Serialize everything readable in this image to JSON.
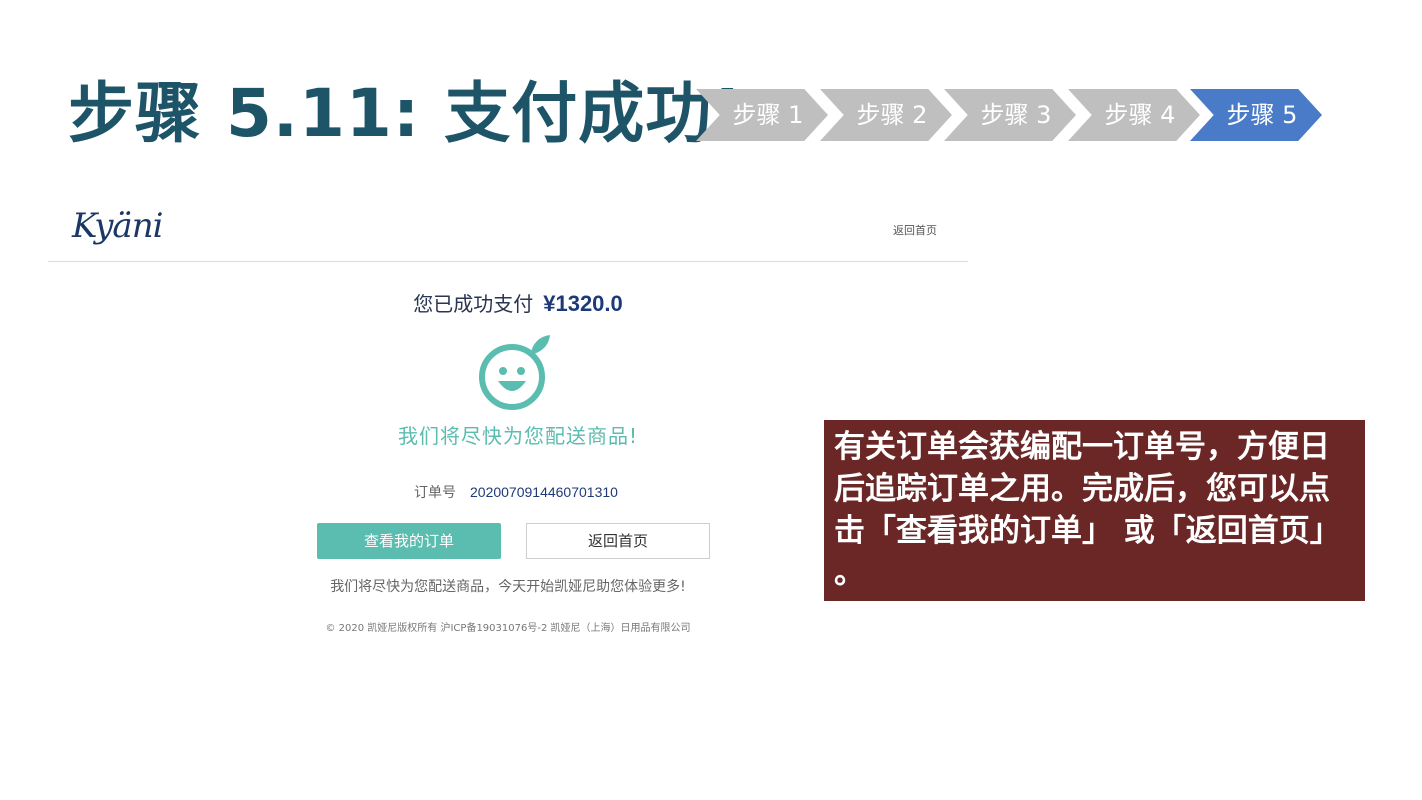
{
  "slide": {
    "title": "步骤 5.11: 支付成功!",
    "steps": [
      "步骤 1",
      "步骤 2",
      "步骤 3",
      "步骤 4",
      "步骤 5"
    ],
    "active_step_index": 4,
    "colors": {
      "title": "#1e5468",
      "step_inactive": "#bfbfbf",
      "step_active": "#4a7bc8",
      "note_bg": "#6b2626"
    }
  },
  "page": {
    "logo_text": "Kyäni",
    "home_link": "返回首页",
    "paid_label": "您已成功支付",
    "amount": "¥1320.0",
    "smile_icon": "smiley-face-icon",
    "ship_message": "我们将尽快为您配送商品!",
    "order_label": "订单号",
    "order_number": "2020070914460701310",
    "buttons": {
      "my_orders": "查看我的订单",
      "home": "返回首页"
    },
    "slogan": "我们将尽快为您配送商品，今天开始凯娅尼助您体验更多!",
    "footer": "© 2020 凯娅尼版权所有  沪ICP备19031076号-2  凯娅尼（上海）日用品有限公司",
    "accent": "#5bbcb0"
  },
  "note": {
    "text": "有关订单会获编配一订单号，方便日后追踪订单之用。完成后，您可以点击「查看我的订单」 或「返回首页」 。"
  }
}
